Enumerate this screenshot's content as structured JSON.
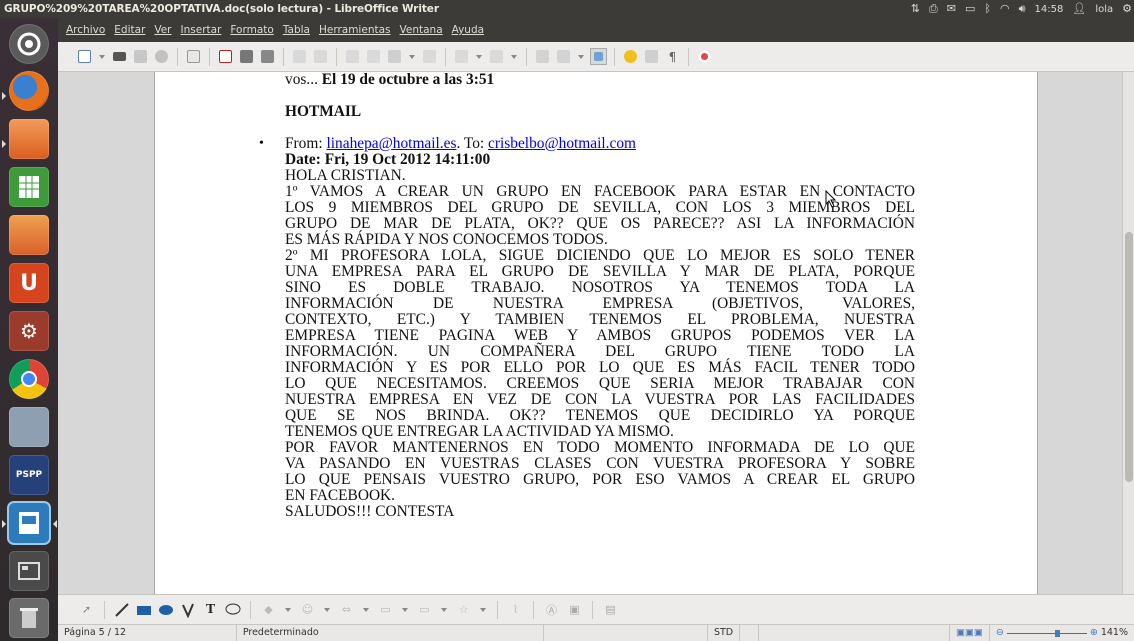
{
  "window": {
    "title": "GRUPO%209%20TAREA%20OPTATIVA.doc(solo lectura) - LibreOffice Writer"
  },
  "indicators": {
    "time": "14:58",
    "user": "lola"
  },
  "menubar": {
    "items": [
      "Archivo",
      "Editar",
      "Ver",
      "Insertar",
      "Formato",
      "Tabla",
      "Herramientas",
      "Ventana",
      "Ayuda"
    ]
  },
  "document": {
    "line_date_prefix": "vos... ",
    "line_date_bold": "El 19 de octubre a las 3:51",
    "heading": "HOTMAIL",
    "from_label": "From: ",
    "from_email": "linahepa@hotmail.es",
    "to_label": ". To: ",
    "to_email": "crisbelbo@hotmail.com",
    "date_line": "Date: Fri, 19 Oct 2012 14:11:00",
    "lines": [
      "HOLA CRISTIAN.",
      "1º VAMOS A CREAR UN GRUPO EN FACEBOOK PARA ESTAR EN CONTACTO",
      "LOS 9 MIEMBROS DEL GRUPO DE SEVILLA, CON LOS 3 MIEMBROS DEL",
      "GRUPO DE MAR DE PLATA, OK?? QUE OS PARECE?? ASI LA INFORMACIÓN",
      "ES MÁS RÁPIDA Y NOS CONOCEMOS TODOS.",
      "2º MI PROFESORA LOLA, SIGUE DICIENDO QUE LO MEJOR ES SOLO TENER",
      "UNA EMPRESA PARA EL GRUPO DE SEVILLA Y MAR DE PLATA, PORQUE",
      "SINO ES DOBLE TRABAJO. NOSOTROS YA TENEMOS TODA LA",
      "INFORMACIÓN DE NUESTRA EMPRESA (OBJETIVOS, VALORES,",
      "CONTEXTO, ETC.) Y TAMBIEN TENEMOS EL PROBLEMA, NUESTRA",
      "EMPRESA TIENE PAGINA WEB Y AMBOS GRUPOS PODEMOS VER LA",
      "INFORMACIÓN. UN COMPAÑERA DEL GRUPO TIENE TODO LA",
      "INFORMACIÓN Y ES POR ELLO POR LO QUE ES MÁS FACIL TENER TODO",
      "LO QUE NECESITAMOS. CREEMOS QUE SERIA MEJOR TRABAJAR CON",
      "NUESTRA EMPRESA EN VEZ DE CON LA VUESTRA POR LAS FACILIDADES",
      "QUE SE NOS BRINDA. OK?? TENEMOS QUE DECIDIRLO YA PORQUE",
      "TENEMOS QUE ENTREGAR LA ACTIVIDAD YA MISMO.",
      "POR FAVOR MANTENERNOS EN TODO MOMENTO INFORMADA DE LO QUE",
      "VA PASANDO EN VUESTRAS CLASES CON VUESTRA PROFESORA Y SOBRE",
      "LO QUE PENSAIS VUESTRO GRUPO, POR ESO VAMOS A CREAR EL GRUPO",
      "EN FACEBOOK.",
      "SALUDOS!!! CONTESTA"
    ]
  },
  "statusbar": {
    "page": "Página 5 / 12",
    "style": "Predeterminado",
    "mode": "STD",
    "zoom": "141%"
  },
  "colors": {
    "panel": "#3c3b37",
    "toolbar": "#edeceb",
    "link": "#0000ee"
  }
}
